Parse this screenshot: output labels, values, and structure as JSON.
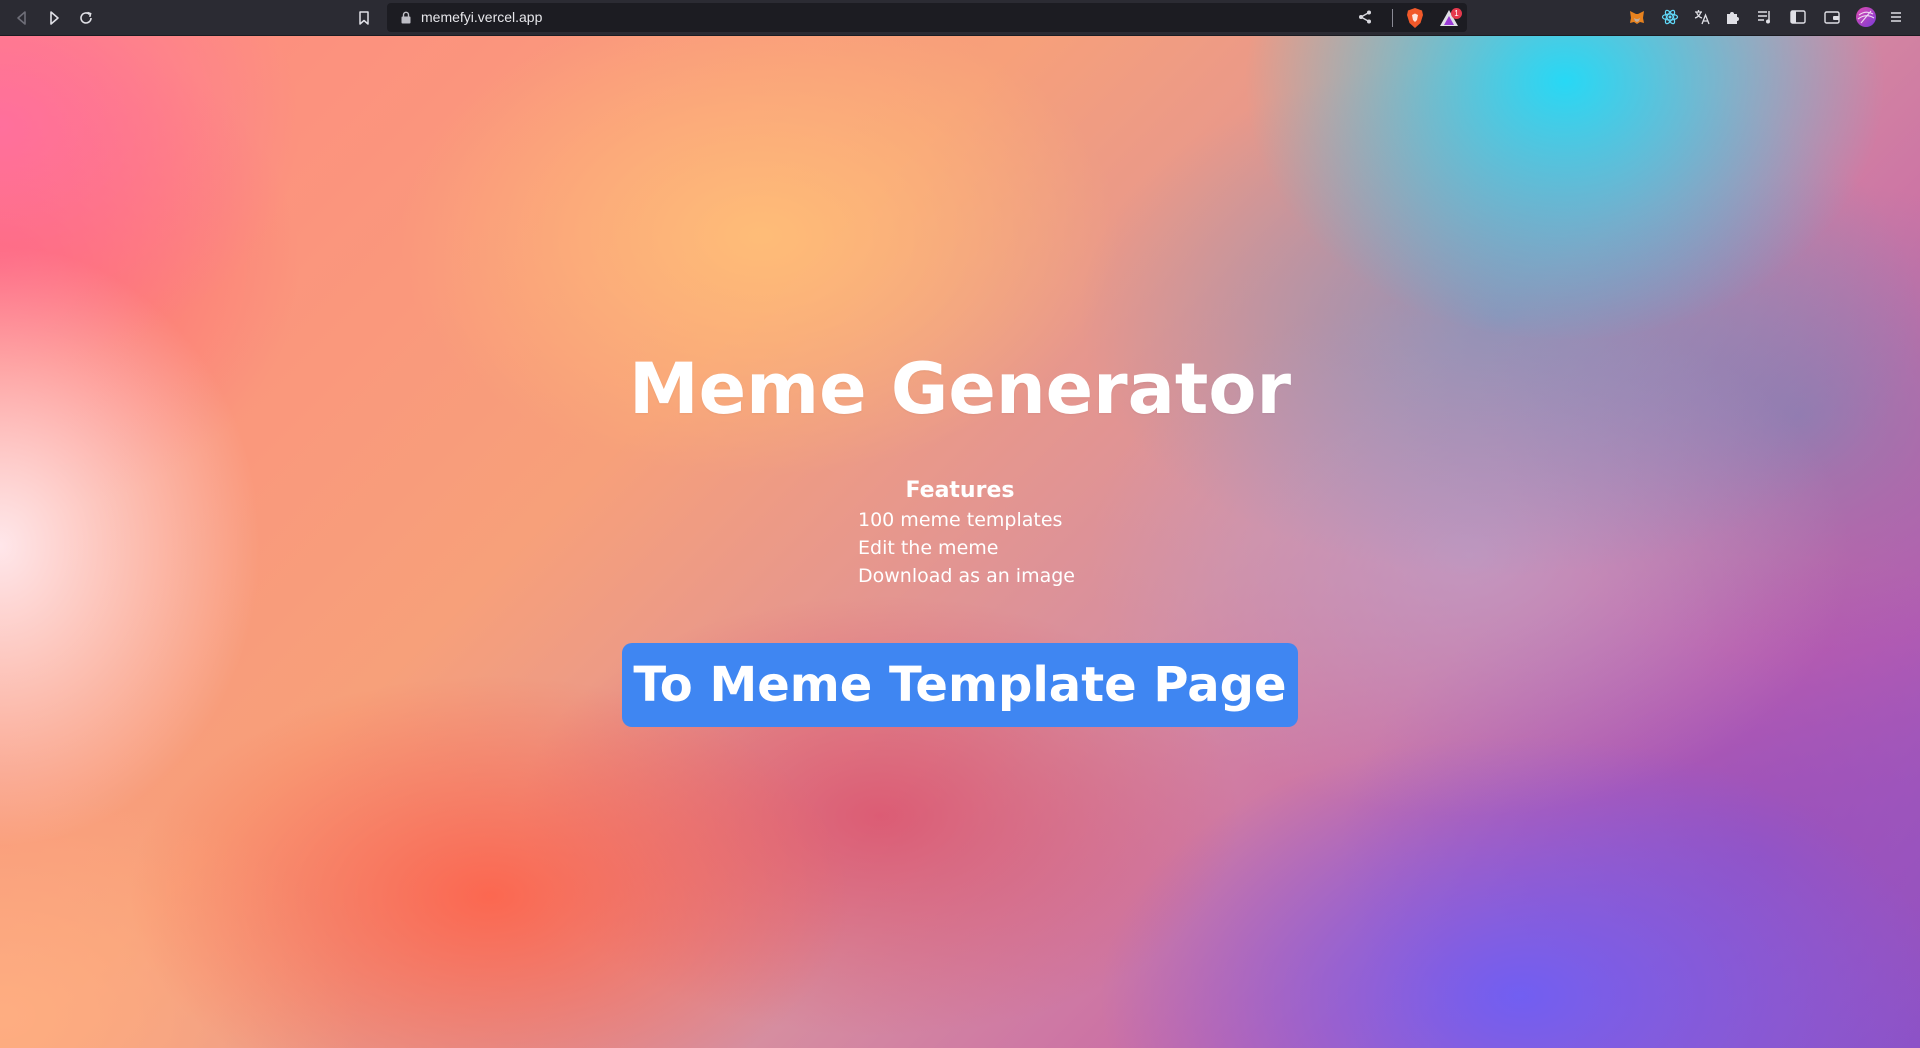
{
  "browser": {
    "url": "memefyi.vercel.app",
    "rewards_badge": "1",
    "icons": {
      "back": "back-arrow-icon",
      "forward": "forward-arrow-icon",
      "reload": "reload-icon",
      "bookmark": "bookmark-icon",
      "lock": "lock-icon",
      "share": "share-icon",
      "shields": "brave-shields-icon",
      "rewards": "brave-rewards-icon",
      "extensions": [
        "metamask-icon",
        "react-devtools-icon",
        "translate-icon",
        "extensions-puzzle-icon",
        "playlist-icon",
        "sidebar-icon",
        "wallet-icon",
        "profile-avatar-icon",
        "menu-icon"
      ]
    },
    "colors": {
      "toolbar_bg": "#2b2b33",
      "url_bar_bg": "#1c1c22"
    }
  },
  "page": {
    "title": "Meme Generator",
    "features": {
      "heading": "Features",
      "items": [
        "100 meme templates",
        "Edit the meme",
        "Download as an image"
      ]
    },
    "cta_label": "To Meme Template Page",
    "colors": {
      "cta_bg": "#3f86f2",
      "text": "#ffffff"
    }
  }
}
